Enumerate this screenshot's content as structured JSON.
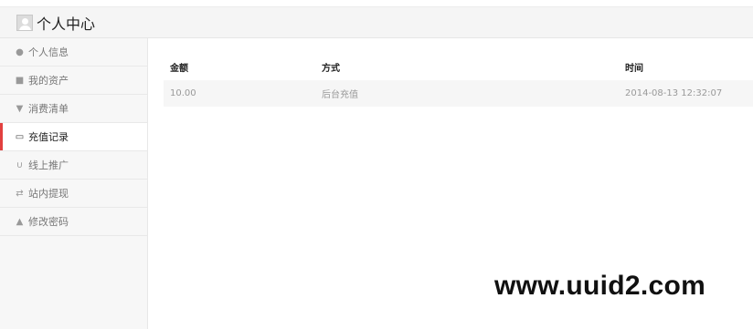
{
  "header": {
    "title": "个人中心"
  },
  "sidebar": {
    "items": [
      {
        "icon": "user-icon",
        "glyph": "👤",
        "label": "个人信息"
      },
      {
        "icon": "briefcase-icon",
        "glyph": "💼",
        "label": "我的资产"
      },
      {
        "icon": "cart-icon",
        "glyph": "🛒",
        "label": "消费清单"
      },
      {
        "icon": "inbox-icon",
        "glyph": "📥",
        "label": "充值记录",
        "active": true
      },
      {
        "icon": "magnet-icon",
        "glyph": "🧲",
        "label": "线上推广"
      },
      {
        "icon": "shuffle-icon",
        "glyph": "🔀",
        "label": "站内提现"
      },
      {
        "icon": "lock-icon",
        "glyph": "🔒",
        "label": "修改密码"
      }
    ]
  },
  "table": {
    "headers": [
      "金额",
      "方式",
      "时间"
    ],
    "rows": [
      [
        "10.00",
        "后台充值",
        "2014-08-13 12:32:07"
      ]
    ]
  },
  "watermark": "www.uuid2.com",
  "colors": {
    "accent": "#e2403f",
    "sidebar_bg": "#f7f7f7",
    "row_bg": "#f6f6f6"
  }
}
